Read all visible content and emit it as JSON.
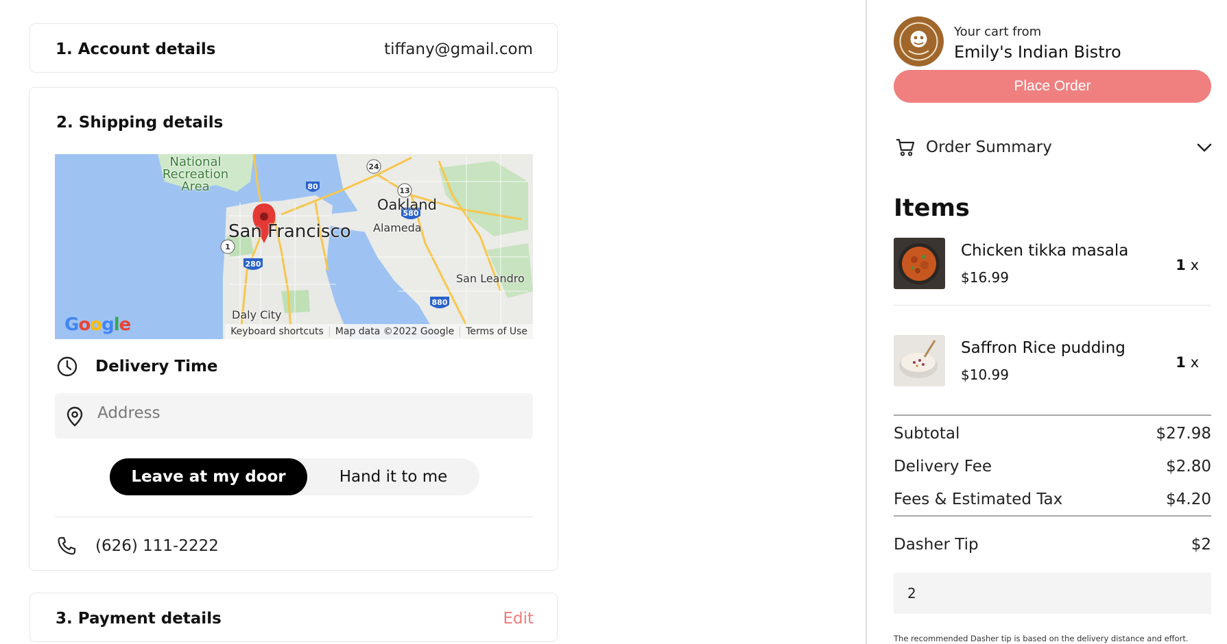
{
  "account": {
    "title": "1. Account details",
    "email": "tiffany@gmail.com"
  },
  "shipping": {
    "title": "2. Shipping details",
    "map": {
      "labels": {
        "park": "National Recreation Area",
        "sf": "San Francisco",
        "oakland": "Oakland",
        "alameda": "Alameda",
        "san_leandro": "San Leandro",
        "daly_city": "Daly City"
      },
      "highways": {
        "i80": "80",
        "i580": "580",
        "i280": "280",
        "i880": "880",
        "r24": "24",
        "r13": "13",
        "r1": "1"
      },
      "footer": {
        "shortcuts": "Keyboard shortcuts",
        "data": "Map data ©2022 Google",
        "terms": "Terms of Use"
      },
      "logo": "Google"
    },
    "delivery_time_label": "Delivery Time",
    "address_placeholder": "Address",
    "dropoff": {
      "option_selected": "Leave at my door",
      "option_other": "Hand it to me"
    },
    "phone": "(626) 111-2222"
  },
  "payment": {
    "title": "3. Payment details",
    "edit_label": "Edit"
  },
  "cart": {
    "from_label": "Your cart from",
    "restaurant": "Emily's Indian Bistro",
    "place_order": "Place Order",
    "order_summary": "Order Summary",
    "items_heading": "Items",
    "items": [
      {
        "name": "Chicken tikka masala",
        "price": "$16.99",
        "qty": "1",
        "x": "x"
      },
      {
        "name": "Saffron Rice pudding",
        "price": "$10.99",
        "qty": "1",
        "x": "x"
      }
    ],
    "totals": {
      "subtotal_label": "Subtotal",
      "subtotal": "$27.98",
      "delivery_label": "Delivery Fee",
      "delivery": "$2.80",
      "fees_label": "Fees & Estimated Tax",
      "fees": "$4.20",
      "tip_label": "Dasher Tip",
      "tip": "$2"
    },
    "tip_input_value": "2",
    "tip_note": "The recommended Dasher tip is based on the delivery distance and effort."
  },
  "colors": {
    "accent": "#f08080",
    "edit": "#ef7b7b",
    "toggle_on": "#000000"
  }
}
